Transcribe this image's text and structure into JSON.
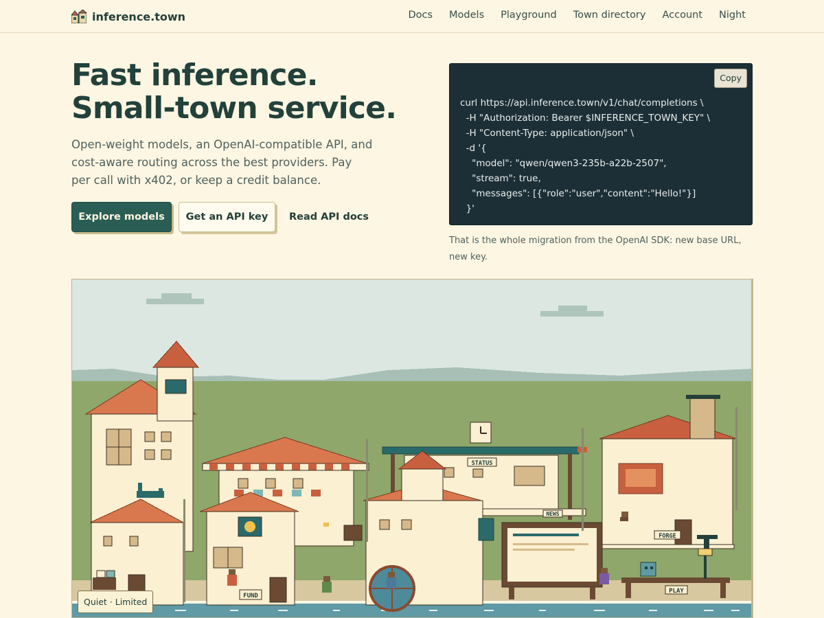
{
  "header": {
    "brand": "inference.town",
    "nav": [
      "Docs",
      "Models",
      "Playground",
      "Town directory",
      "Account",
      "Night"
    ]
  },
  "hero": {
    "title_line1": "Fast inference.",
    "title_line2": "Small-town service.",
    "subtitle": "Open-weight models, an OpenAI-compatible API, and cost-aware routing across the best providers. Pay per call with x402, or keep a credit balance.",
    "primary_button": "Explore models",
    "secondary_button": "Get an API key",
    "link_button": "Read API docs"
  },
  "code": {
    "copy_label": "Copy",
    "lines": [
      "curl https://api.inference.town/v1/chat/completions \\",
      "  -H \"Authorization: Bearer $INFERENCE_TOWN_KEY\" \\",
      "  -H \"Content-Type: application/json\" \\",
      "  -d '{",
      "    \"model\": \"qwen/qwen3-235b-a22b-2507\",",
      "    \"stream\": true,",
      "    \"messages\": [{\"role\":\"user\",\"content\":\"Hello!\"}]",
      "  }'"
    ],
    "note": "That is the whole migration from the OpenAI SDK: new base URL, new key."
  },
  "town": {
    "signs": {
      "status": "STATUS",
      "news": "NEWS",
      "forge": "FORGE",
      "fund": "FUND",
      "play": "PLAY"
    },
    "status_pill": "Quiet · Limited"
  },
  "colors": {
    "background": "#fdf6e3",
    "ink": "#23403a",
    "primary": "#2a5e55",
    "code_bg": "#1c2f37",
    "roof": "#c8603f",
    "grass": "#8fa76a",
    "sky": "#dbe7e0",
    "water": "#5f9aa5"
  }
}
